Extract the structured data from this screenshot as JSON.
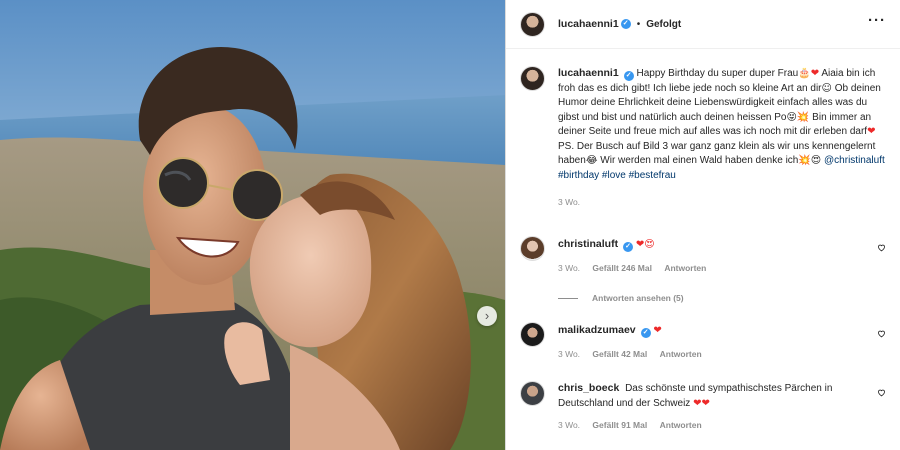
{
  "post": {
    "author": "lucahaenni1",
    "follow_status": "Gefolgt",
    "separator": "•",
    "more_icon": "more-options-icon",
    "next_icon": "chevron-right-icon"
  },
  "caption": {
    "username": "lucahaenni1",
    "text_1": "Happy Birthday du super duper Frau",
    "emoji_1": "🎂❤",
    "text_2": "Aiaia bin ich froh das es dich gibt! Ich liebe jede noch so kleine Art an dir",
    "emoji_2": "☺",
    "text_3": "Ob deinen Humor deine Ehrlichkeit deine Liebenswürdigkeit einfach alles was du gibst und bist und natürlich auch deinen heissen Po",
    "emoji_3": "😝💥",
    "text_4": "Bin immer an deiner Seite und freue mich auf alles was ich noch mit dir erleben darf",
    "emoji_4": "❤",
    "text_5": "PS. Der Busch auf Bild 3 war ganz ganz klein als wir uns kennengelernt haben",
    "emoji_5": "😂",
    "text_6": "Wir werden mal einen Wald haben denke ich",
    "emoji_6": "💥😍",
    "mention": "@christinaluft",
    "hashtags": "#birthday #love #bestefrau",
    "time": "3 Wo."
  },
  "comments": [
    {
      "username": "christinaluft",
      "emoji": "❤😍",
      "text": "",
      "time": "3 Wo.",
      "likes": "Gefällt 246 Mal",
      "reply": "Antworten"
    },
    {
      "username": "malikadzumaev",
      "emoji": "❤",
      "text": "",
      "time": "3 Wo.",
      "likes": "Gefällt 42 Mal",
      "reply": "Antworten"
    },
    {
      "username": "chris_boeck",
      "text": "Das schönste und sympathischstes Pärchen in Deutschland und der Schweiz",
      "emoji": "❤❤",
      "time": "3 Wo.",
      "likes": "Gefällt 91 Mal",
      "reply": "Antworten"
    }
  ],
  "view_replies": "Antworten ansehen (5)",
  "colors": {
    "verified": "#3897f0",
    "heart": "#ed2a2a",
    "link": "#00376b",
    "muted": "#8e8e8e"
  }
}
